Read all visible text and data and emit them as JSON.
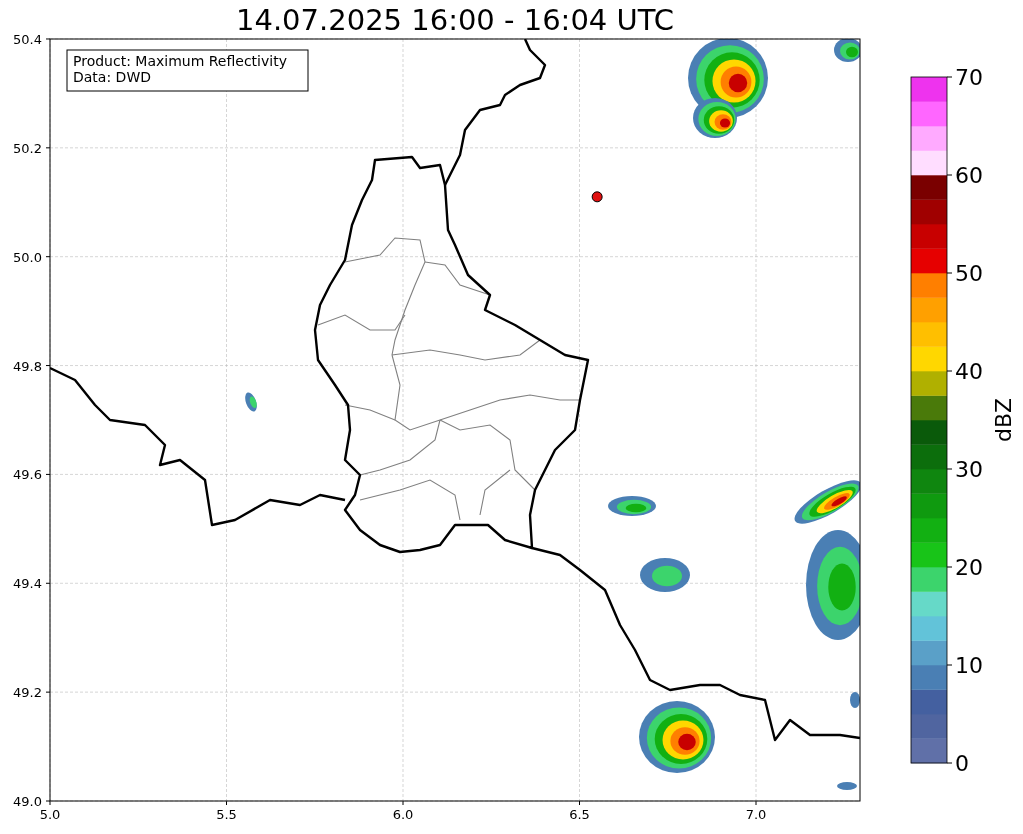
{
  "title": "14.07.2025 16:00 - 16:04 UTC",
  "legend": [
    "Product: Maximum Reflectivity",
    "Data: DWD"
  ],
  "x_ticks": [
    "5.0",
    "5.5",
    "6.0",
    "6.5",
    "7.0"
  ],
  "y_ticks": [
    "50.4",
    "50.2",
    "50.0",
    "49.8",
    "49.6",
    "49.4",
    "49.2",
    "49.0"
  ],
  "colorbar": {
    "label": "dBZ",
    "ticks": [
      "70",
      "60",
      "50",
      "40",
      "30",
      "20",
      "10",
      "0"
    ],
    "segments": [
      {
        "color": "#6070a8"
      },
      {
        "color": "#5065a0"
      },
      {
        "color": "#4460a0"
      },
      {
        "color": "#4a7fb4"
      },
      {
        "color": "#5aa0c8"
      },
      {
        "color": "#62c3d9"
      },
      {
        "color": "#66d9c8"
      },
      {
        "color": "#3cd46c"
      },
      {
        "color": "#18c418"
      },
      {
        "color": "#12b012"
      },
      {
        "color": "#0f9a0f"
      },
      {
        "color": "#0f860f"
      },
      {
        "color": "#0c6e0c"
      },
      {
        "color": "#0a5a0a"
      },
      {
        "color": "#4a7a0a"
      },
      {
        "color": "#b0b000"
      },
      {
        "color": "#ffd700"
      },
      {
        "color": "#ffbf00"
      },
      {
        "color": "#ffa000"
      },
      {
        "color": "#ff7f00"
      },
      {
        "color": "#e60000"
      },
      {
        "color": "#c80000"
      },
      {
        "color": "#a00000"
      },
      {
        "color": "#7a0000"
      },
      {
        "color": "#ffddff"
      },
      {
        "color": "#ffaaff"
      },
      {
        "color": "#ff66ff"
      },
      {
        "color": "#ee33ee"
      }
    ]
  }
}
